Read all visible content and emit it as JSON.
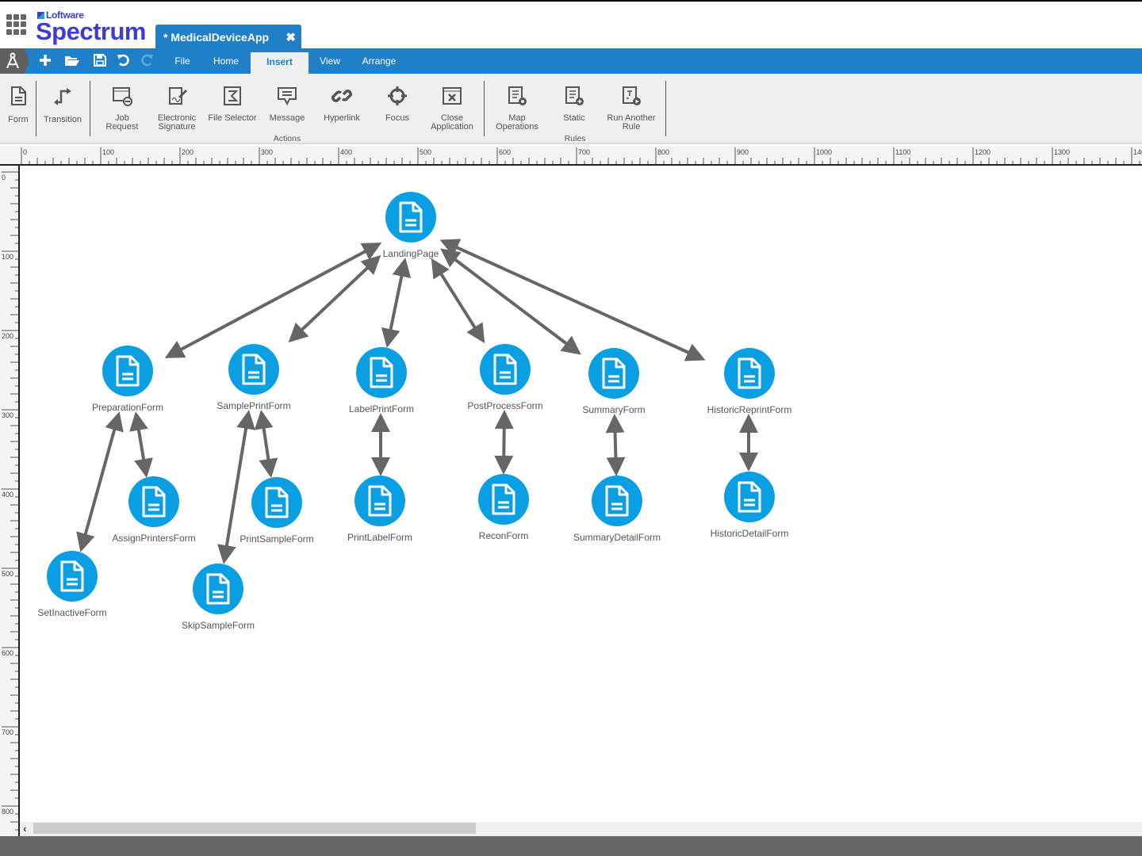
{
  "brand": {
    "company": "Loftware",
    "product": "Spectrum"
  },
  "document_tab": {
    "title": "* MedicalDeviceApp",
    "close_icon": "close-icon"
  },
  "quick_access": [
    {
      "name": "new",
      "icon": "plus-icon"
    },
    {
      "name": "open",
      "icon": "folder-open-icon"
    },
    {
      "name": "save",
      "icon": "save-icon"
    },
    {
      "name": "undo",
      "icon": "undo-icon"
    },
    {
      "name": "redo",
      "icon": "redo-icon",
      "disabled": true
    }
  ],
  "menu": {
    "items": [
      {
        "label": "File"
      },
      {
        "label": "Home"
      },
      {
        "label": "Insert",
        "active": true
      },
      {
        "label": "View"
      },
      {
        "label": "Arrange"
      }
    ]
  },
  "ribbon": {
    "form": {
      "label": "Form",
      "icon": "form-document-icon"
    },
    "transition": {
      "label": "Transition",
      "icon": "transition-icon"
    },
    "actions": {
      "group_label": "Actions",
      "items": [
        {
          "label": "Job\nRequest",
          "line1": "Job",
          "line2": "Request",
          "icon": "job-request-icon"
        },
        {
          "label": "Electronic Signature",
          "line1": "Electronic",
          "line2": "Signature",
          "icon": "signature-icon"
        },
        {
          "label": "File Selector",
          "line1": "File Selector",
          "line2": "",
          "icon": "file-selector-icon"
        },
        {
          "label": "Message",
          "line1": "Message",
          "line2": "",
          "icon": "message-icon"
        },
        {
          "label": "Hyperlink",
          "line1": "Hyperlink",
          "line2": "",
          "icon": "link-icon"
        },
        {
          "label": "Focus",
          "line1": "Focus",
          "line2": "",
          "icon": "crosshair-icon"
        },
        {
          "label": "Close Application",
          "line1": "Close",
          "line2": "Application",
          "icon": "close-window-icon"
        }
      ]
    },
    "rules": {
      "group_label": "Rules",
      "items": [
        {
          "label": "Map Operations",
          "line1": "Map",
          "line2": "Operations",
          "icon": "map-operations-icon"
        },
        {
          "label": "Static",
          "line1": "Static",
          "line2": "",
          "icon": "static-rule-icon"
        },
        {
          "label": "Run Another Rule",
          "line1": "Run Another",
          "line2": "Rule",
          "icon": "run-rule-icon"
        }
      ]
    }
  },
  "rulers": {
    "horizontal_labels": [
      "0",
      "100",
      "200",
      "300",
      "400",
      "500",
      "600",
      "700",
      "800",
      "900",
      "1000",
      "1100",
      "1200",
      "1300",
      "140"
    ],
    "vertical_labels": [
      "0",
      "100",
      "200",
      "300",
      "400",
      "500",
      "600",
      "700",
      "800"
    ]
  },
  "diagram": {
    "nodes": [
      {
        "id": "LandingPage",
        "label": "LandingPage"
      },
      {
        "id": "PreparationForm",
        "label": "PreparationForm"
      },
      {
        "id": "SamplePrintForm",
        "label": "SamplePrintForm"
      },
      {
        "id": "LabelPrintForm",
        "label": "LabelPrintForm"
      },
      {
        "id": "PostProcessForm",
        "label": "PostProcessForm"
      },
      {
        "id": "SummaryForm",
        "label": "SummaryForm"
      },
      {
        "id": "HistoricReprintForm",
        "label": "HistoricReprintForm"
      },
      {
        "id": "AssignPrintersForm",
        "label": "AssignPrintersForm"
      },
      {
        "id": "PrintSampleForm",
        "label": "PrintSampleForm"
      },
      {
        "id": "PrintLabelForm",
        "label": "PrintLabelForm"
      },
      {
        "id": "ReconForm",
        "label": "ReconForm"
      },
      {
        "id": "SummaryDetailForm",
        "label": "SummaryDetailForm"
      },
      {
        "id": "HistoricDetailForm",
        "label": "HistoricDetailForm"
      },
      {
        "id": "SetInactiveForm",
        "label": "SetInactiveForm"
      },
      {
        "id": "SkipSampleForm",
        "label": "SkipSampleForm"
      }
    ],
    "edges": [
      {
        "from": "LandingPage",
        "to": "PreparationForm",
        "bidirectional": true
      },
      {
        "from": "LandingPage",
        "to": "SamplePrintForm",
        "bidirectional": true
      },
      {
        "from": "LandingPage",
        "to": "LabelPrintForm",
        "bidirectional": true
      },
      {
        "from": "LandingPage",
        "to": "PostProcessForm",
        "bidirectional": true
      },
      {
        "from": "LandingPage",
        "to": "SummaryForm",
        "bidirectional": true
      },
      {
        "from": "LandingPage",
        "to": "HistoricReprintForm",
        "bidirectional": true
      },
      {
        "from": "PreparationForm",
        "to": "SetInactiveForm",
        "bidirectional": true
      },
      {
        "from": "PreparationForm",
        "to": "AssignPrintersForm",
        "bidirectional": true
      },
      {
        "from": "SamplePrintForm",
        "to": "SkipSampleForm",
        "bidirectional": true
      },
      {
        "from": "SamplePrintForm",
        "to": "PrintSampleForm",
        "bidirectional": true
      },
      {
        "from": "LabelPrintForm",
        "to": "PrintLabelForm",
        "bidirectional": true
      },
      {
        "from": "PostProcessForm",
        "to": "ReconForm",
        "bidirectional": true
      },
      {
        "from": "SummaryForm",
        "to": "SummaryDetailForm",
        "bidirectional": true
      },
      {
        "from": "HistoricReprintForm",
        "to": "HistoricDetailForm",
        "bidirectional": true
      }
    ]
  },
  "colors": {
    "accent": "#1f80c8",
    "node": "#0a9fe2",
    "brand": "#3d3ad6",
    "edge": "#666666"
  }
}
